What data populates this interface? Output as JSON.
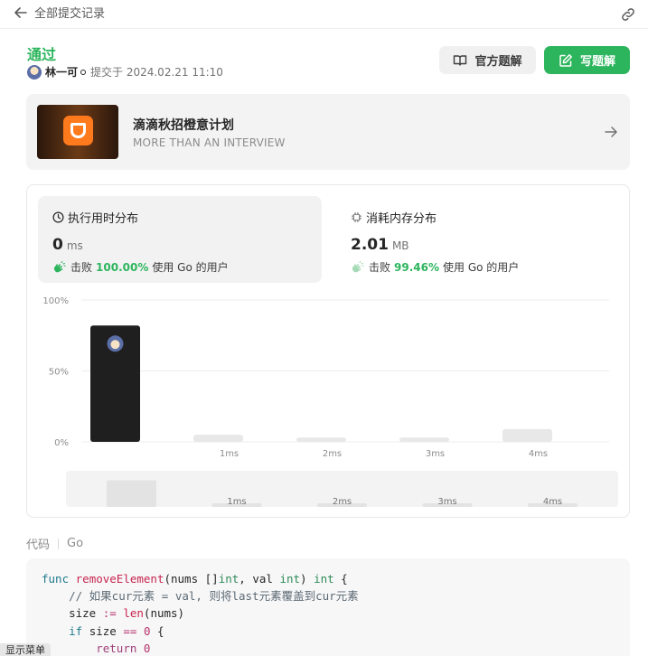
{
  "topbar": {
    "back_label": "全部提交记录"
  },
  "submission": {
    "status": "通过",
    "username": "林一可",
    "submitted_text": "提交于 2024.02.21 11:10"
  },
  "actions": {
    "official_label": "官方题解",
    "write_label": "写题解"
  },
  "banner": {
    "title": "滴滴秋招橙意计划",
    "subtitle": "MORE THAN AN INTERVIEW"
  },
  "runtime": {
    "title": "执行用时分布",
    "value": "0",
    "unit": "ms",
    "beat_prefix": "击败",
    "beat_pct": "100.00%",
    "beat_suffix": "使用 Go 的用户"
  },
  "memory": {
    "title": "消耗内存分布",
    "value": "2.01",
    "unit": "MB",
    "beat_prefix": "击败",
    "beat_pct": "99.46%",
    "beat_suffix": "使用 Go 的用户"
  },
  "chart_data": {
    "type": "bar",
    "categories": [
      "",
      "1ms",
      "2ms",
      "3ms",
      "4ms"
    ],
    "values": [
      82,
      5,
      3,
      3,
      9
    ],
    "ylim": [
      0,
      100
    ],
    "yticks": [
      "100%",
      "50%",
      "0%"
    ],
    "highlight_index": 0,
    "highlight_color": "#1f1f1f",
    "bar_color": "#e8e8e8",
    "grid": true
  },
  "code": {
    "header_label": "代码",
    "language": "Go"
  },
  "menu_tip": "显示菜单"
}
